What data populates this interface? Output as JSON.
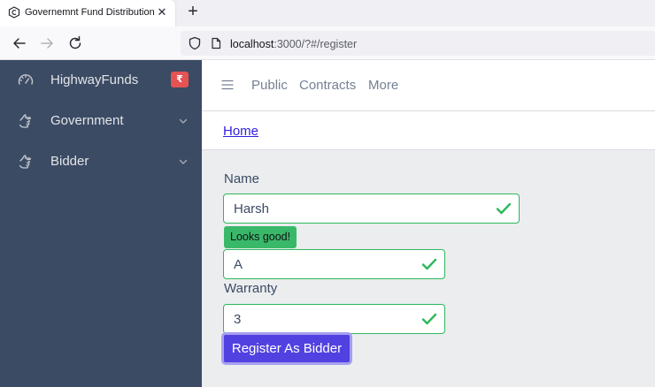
{
  "browser": {
    "tab_title": "Governemnt Fund Distribution",
    "tab_close": "✕",
    "new_tab": "+",
    "url_host": "localhost",
    "url_path": ":3000/?#/register"
  },
  "sidebar": {
    "items": [
      {
        "label": "HighwayFunds",
        "icon": "speedometer-icon",
        "badge": "₹"
      },
      {
        "label": "Government",
        "icon": "puzzle-icon"
      },
      {
        "label": "Bidder",
        "icon": "puzzle-icon"
      }
    ]
  },
  "header": {
    "nav": [
      "Public",
      "Contracts",
      "More"
    ]
  },
  "breadcrumb": {
    "home": "Home"
  },
  "form": {
    "name_label": "Name",
    "name_value": "Harsh",
    "validation_message": "Looks good!",
    "second_value": "A",
    "warranty_label": "Warranty",
    "warranty_value": "3",
    "submit_label": "Register As Bidder"
  },
  "colors": {
    "sidebar_bg": "#3c4b64",
    "valid": "#2eb85c",
    "primary": "#5141e0",
    "badge": "#e55353"
  }
}
